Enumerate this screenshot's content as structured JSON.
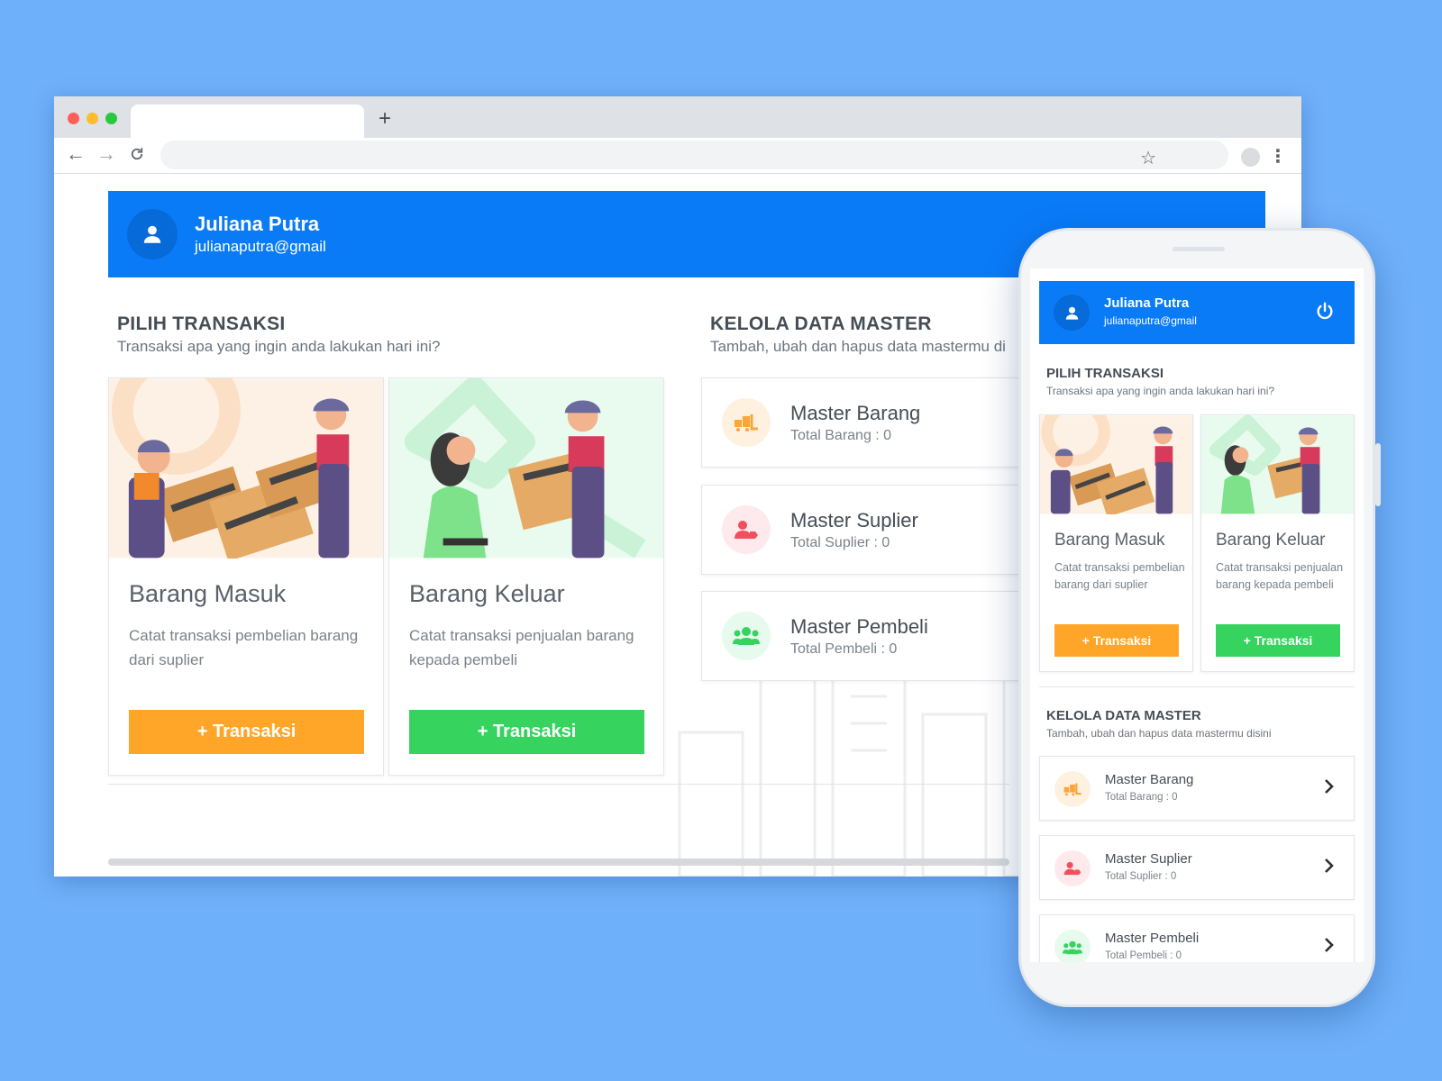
{
  "user": {
    "name": "Juliana Putra",
    "email": "julianaputra@gmail"
  },
  "browser": {
    "new_tab_symbol": "+"
  },
  "transaksi_section": {
    "title": "PILIH TRANSAKSI",
    "subtitle": "Transaksi apa yang ingin anda lakukan hari ini?"
  },
  "master_section": {
    "title": "KELOLA DATA MASTER",
    "subtitle": "Tambah, ubah dan hapus data mastermu disini",
    "subtitle_desktop_visible": "Tambah, ubah dan hapus data mastermu di"
  },
  "transaction_cards": [
    {
      "title": "Barang Masuk",
      "description": "Catat transaksi pembelian barang dari suplier",
      "button": "+ Transaksi",
      "color": "#ffa528"
    },
    {
      "title": "Barang Keluar",
      "description": "Catat transaksi penjualan barang kepada pembeli",
      "button": "+ Transaksi",
      "color": "#36d35f"
    }
  ],
  "master_cards": [
    {
      "title": "Master Barang",
      "subtitle": "Total Barang : 0",
      "icon": "truck-box-icon",
      "color": "#f9a63c"
    },
    {
      "title": "Master Suplier",
      "subtitle": "Total Suplier : 0",
      "icon": "user-tag-icon",
      "color": "#f0505d"
    },
    {
      "title": "Master Pembeli",
      "subtitle": "Total Pembeli : 0",
      "icon": "users-icon",
      "color": "#36d35f"
    }
  ],
  "colors": {
    "primary": "#0a7bf7",
    "background": "#6fb0fb"
  }
}
